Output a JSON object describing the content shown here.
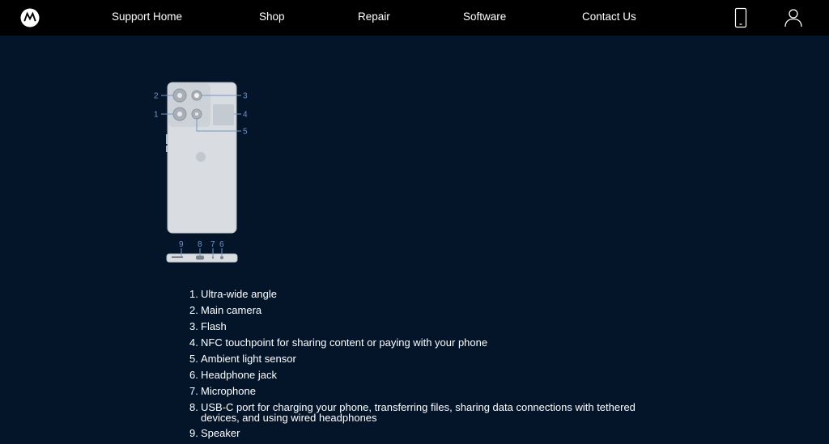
{
  "header": {
    "logo_icon": "motorola-logo-icon",
    "nav": [
      {
        "label": "Support Home"
      },
      {
        "label": "Shop"
      },
      {
        "label": "Repair"
      },
      {
        "label": "Software"
      },
      {
        "label": "Contact Us"
      }
    ],
    "device_icon": "smartphone-icon",
    "account_icon": "user-icon"
  },
  "diagram": {
    "callouts": {
      "c1": "1",
      "c2": "2",
      "c3": "3",
      "c4": "4",
      "c5": "5",
      "c6": "6",
      "c7": "7",
      "c8": "8",
      "c9": "9"
    }
  },
  "specs": [
    {
      "num": "1.",
      "text": "Ultra-wide angle"
    },
    {
      "num": "2.",
      "text": "Main camera"
    },
    {
      "num": "3.",
      "text": "Flash"
    },
    {
      "num": "4.",
      "text": "NFC touchpoint for sharing content or paying with your phone"
    },
    {
      "num": "5.",
      "text": "Ambient light sensor"
    },
    {
      "num": "6.",
      "text": "Headphone jack"
    },
    {
      "num": "7.",
      "text": "Microphone"
    },
    {
      "num": "8.",
      "text": "USB-C port for charging your phone, transferring files, sharing data connections with tethered devices, and using wired headphones"
    },
    {
      "num": "9.",
      "text": "Speaker"
    }
  ],
  "colors": {
    "page_background": "#04152a",
    "header_background": "#000000",
    "callout_color": "#6f97c8",
    "phone_body": "#d9dde2"
  }
}
